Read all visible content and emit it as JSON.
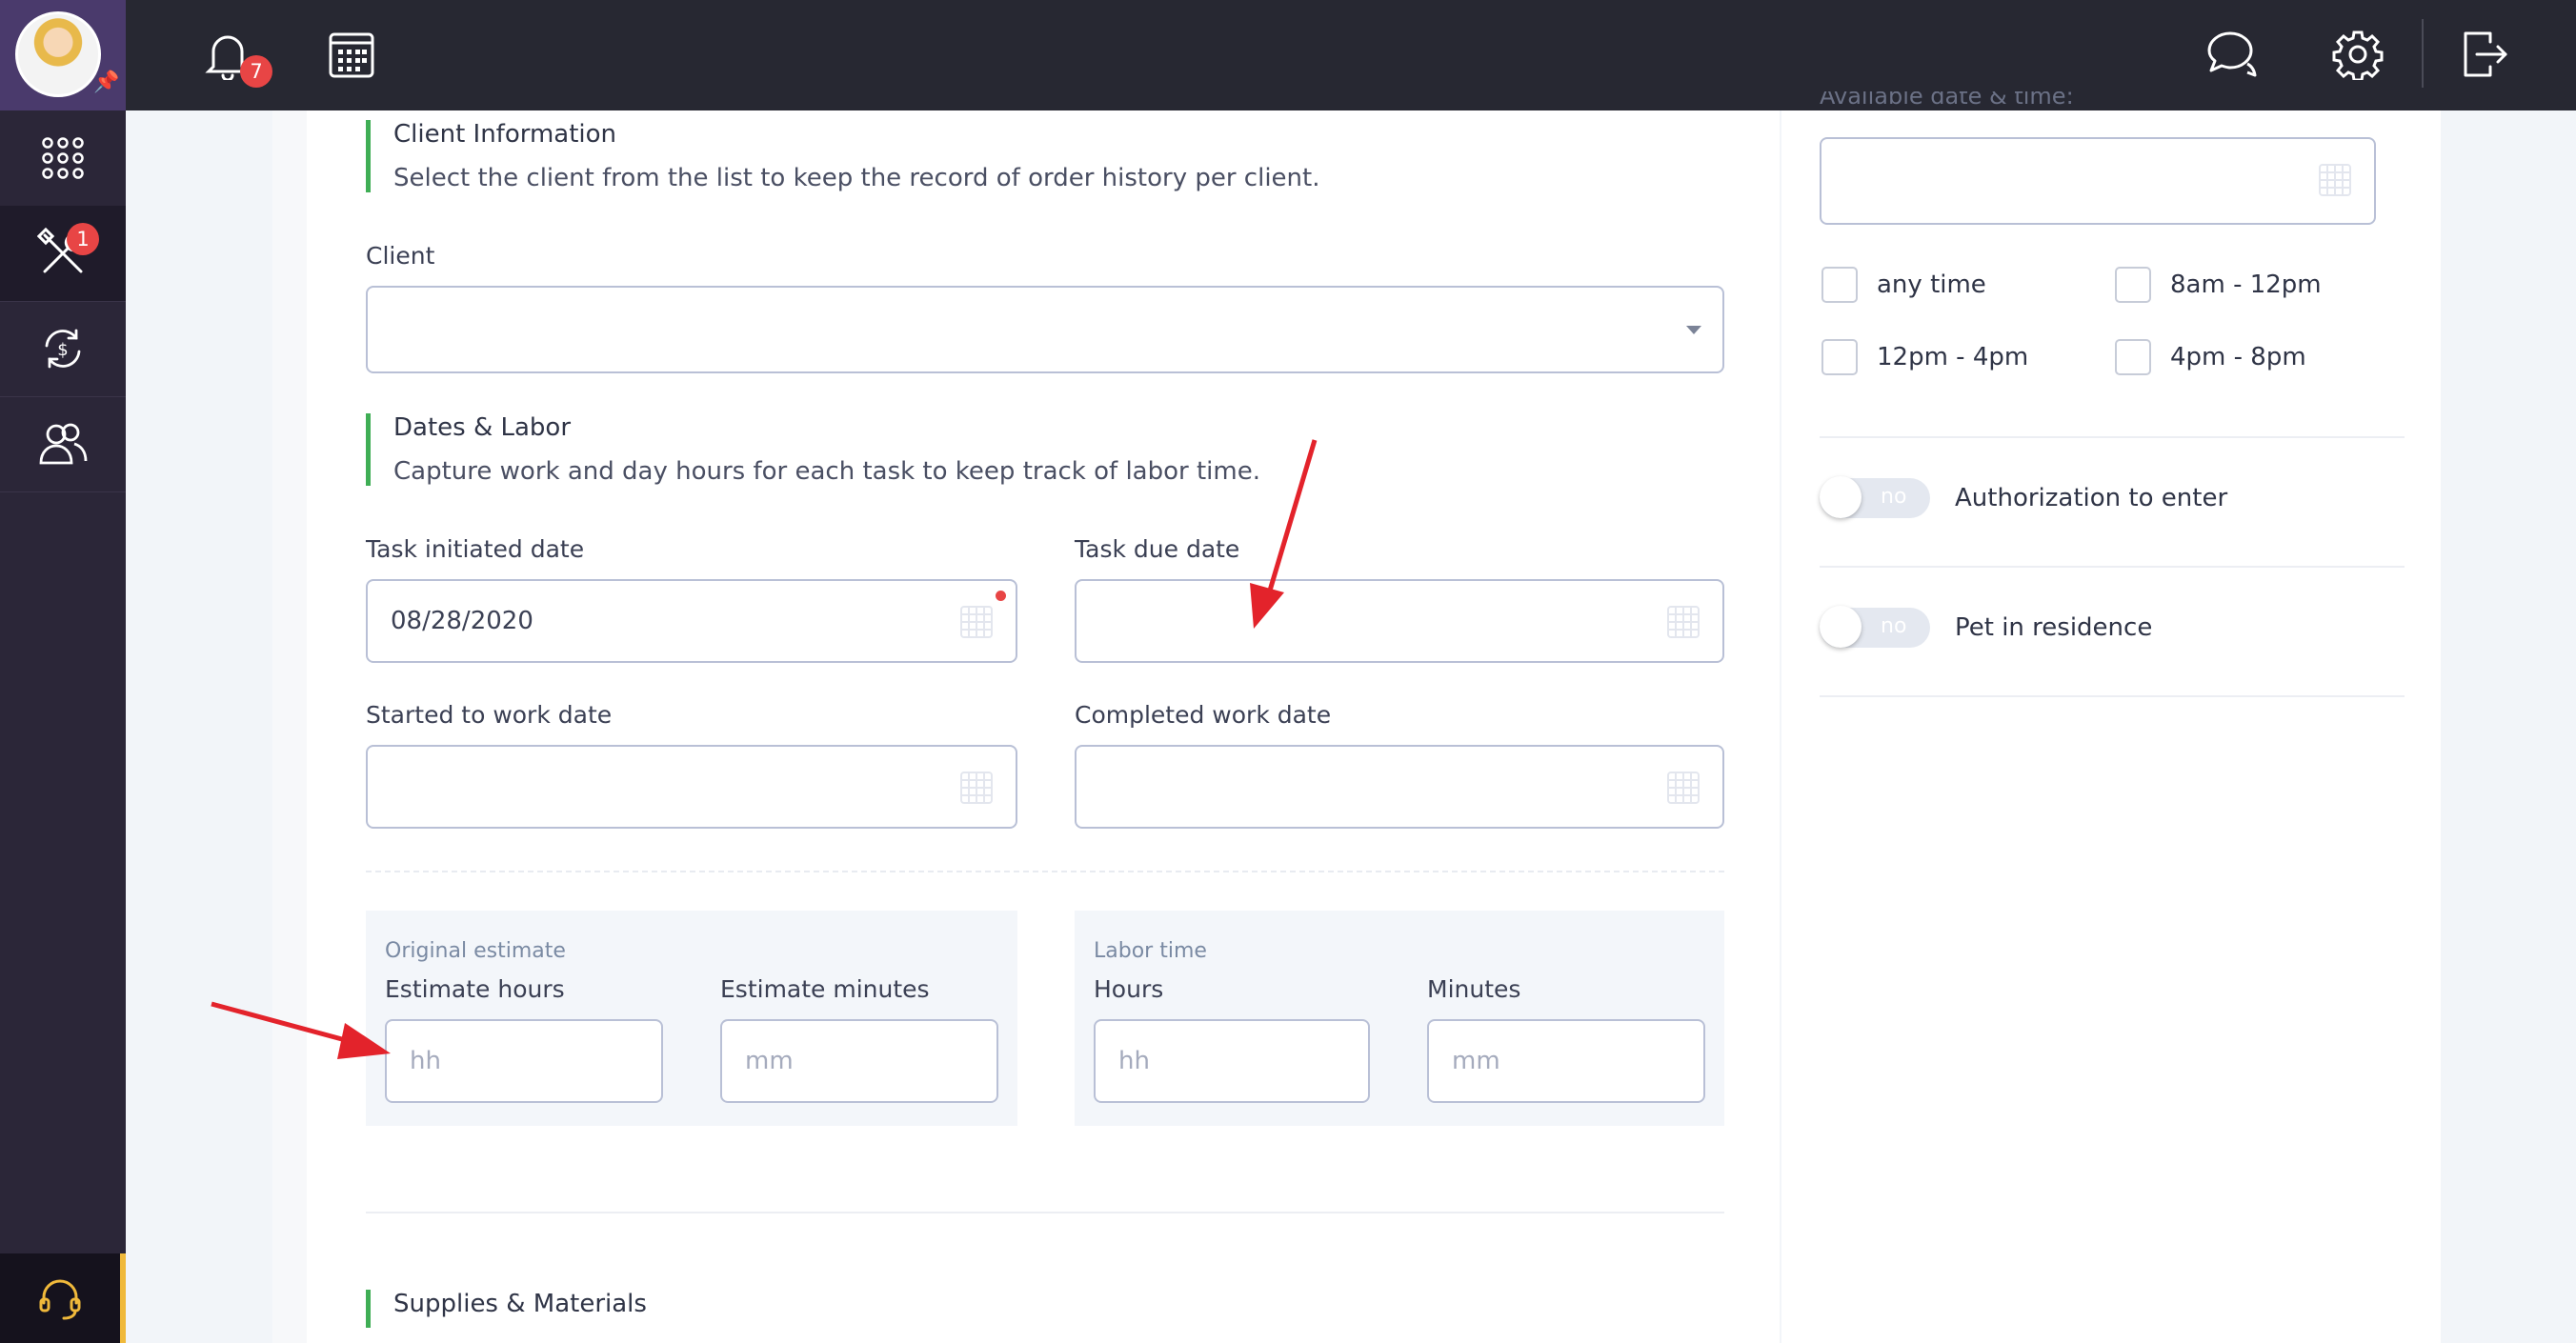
{
  "topbar": {
    "notifications_count": "7"
  },
  "sidebar": {
    "tasks_badge": "1"
  },
  "client_section": {
    "title": "Client Information",
    "description": "Select the client from the list to keep the record of order history per client.",
    "client_label": "Client",
    "client_value": ""
  },
  "dates_section": {
    "title": "Dates & Labor",
    "description": "Capture work and day hours for each task to keep track of labor time.",
    "task_initiated_label": "Task initiated date",
    "task_initiated_value": "08/28/2020",
    "task_due_label": "Task due date",
    "task_due_value": "",
    "started_label": "Started to work date",
    "started_value": "",
    "completed_label": "Completed work date",
    "completed_value": ""
  },
  "estimate": {
    "caption": "Original estimate",
    "hours_label": "Estimate hours",
    "hours_placeholder": "hh",
    "minutes_label": "Estimate minutes",
    "minutes_placeholder": "mm"
  },
  "labor": {
    "caption": "Labor time",
    "hours_label": "Hours",
    "hours_placeholder": "hh",
    "minutes_label": "Minutes",
    "minutes_placeholder": "mm"
  },
  "supplies": {
    "title": "Supplies & Materials"
  },
  "availability": {
    "label": "Available date & time:",
    "options": [
      "any time",
      "8am - 12pm",
      "12pm - 4pm",
      "4pm - 8pm"
    ]
  },
  "toggles": [
    {
      "label": "Authorization to enter",
      "state": "no"
    },
    {
      "label": "Pet in residence",
      "state": "no"
    }
  ],
  "colors": {
    "accent_green": "#3fae55",
    "badge_red": "#e84545",
    "sidebar": "#2b2638",
    "topbar": "#272832",
    "support_accent": "#f0b93b"
  },
  "icons": [
    "pin-icon",
    "apps-grid-icon",
    "tools-icon",
    "money-cycle-icon",
    "users-icon",
    "headset-icon",
    "bell-icon",
    "calendar-icon",
    "chat-icon",
    "gear-icon",
    "logout-icon"
  ]
}
